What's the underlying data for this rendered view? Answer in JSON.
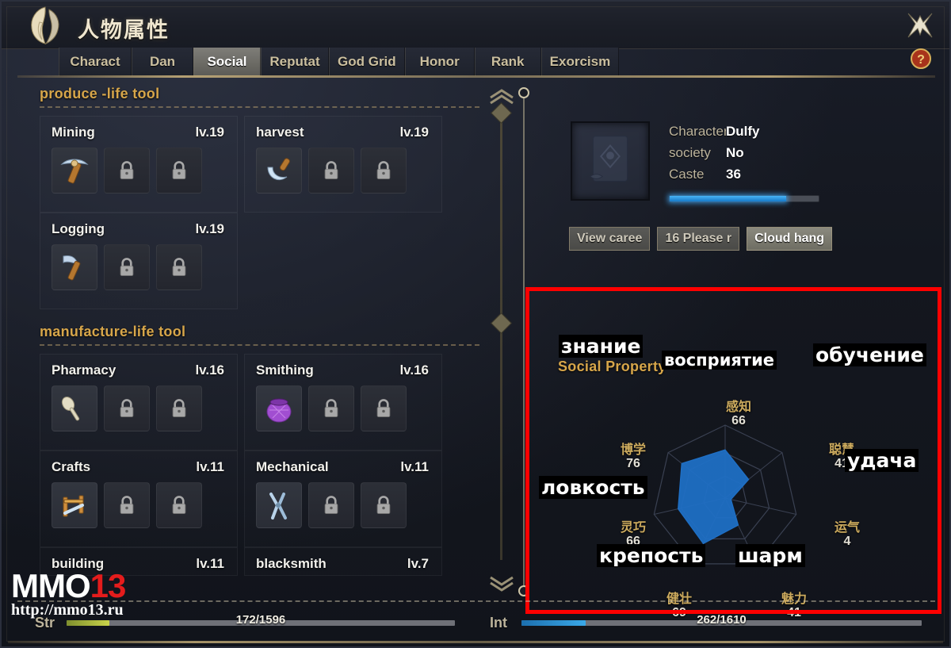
{
  "window": {
    "title_cn": "人物属性",
    "emblem_icon": "helmet-crest-icon",
    "close_icon": "close-star-icon",
    "help_icon": "help-question-icon"
  },
  "tabs": [
    {
      "label": "Charact",
      "active": false
    },
    {
      "label": "Dan",
      "active": false
    },
    {
      "label": "Social",
      "active": true
    },
    {
      "label": "Reputat",
      "active": false
    },
    {
      "label": "God Grid",
      "active": false
    },
    {
      "label": "Honor",
      "active": false
    },
    {
      "label": "Rank",
      "active": false
    },
    {
      "label": "Exorcism",
      "active": false
    }
  ],
  "left_panel": {
    "sections": [
      {
        "title": "produce -life tool",
        "skills": [
          {
            "name": "Mining",
            "level": "lv.19",
            "icon": "pickaxe-icon",
            "slots": [
              "tool",
              "locked",
              "locked"
            ]
          },
          {
            "name": "harvest",
            "level": "lv.19",
            "icon": "sickle-icon",
            "slots": [
              "tool",
              "locked",
              "locked"
            ]
          },
          {
            "name": "Logging",
            "level": "lv.19",
            "icon": "axe-icon",
            "slots": [
              "tool",
              "locked",
              "locked"
            ]
          }
        ]
      },
      {
        "title": "manufacture-life tool",
        "skills": [
          {
            "name": "Pharmacy",
            "level": "lv.16",
            "icon": "spoon-icon",
            "slots": [
              "tool",
              "locked",
              "locked"
            ]
          },
          {
            "name": "Smithing",
            "level": "lv.16",
            "icon": "pot-icon",
            "slots": [
              "tool",
              "locked",
              "locked"
            ]
          },
          {
            "name": "Crafts",
            "level": "lv.11",
            "icon": "loom-icon",
            "slots": [
              "tool",
              "locked",
              "locked"
            ]
          },
          {
            "name": "Mechanical",
            "level": "lv.11",
            "icon": "pliers-icon",
            "slots": [
              "tool",
              "locked",
              "locked"
            ]
          },
          {
            "name": "building",
            "level": "lv.11",
            "icon": "build-icon",
            "slots": []
          },
          {
            "name": "blacksmith",
            "level": "lv.7",
            "icon": "anvil-icon",
            "slots": []
          }
        ]
      }
    ]
  },
  "scrollbar": {
    "up_icon": "chevron-double-up-icon",
    "down_icon": "chevron-double-down-icon"
  },
  "right_panel": {
    "portrait_icon": "scroll-portrait-icon",
    "info_rows": [
      {
        "label": "Character",
        "value": "Dulfy"
      },
      {
        "label": "society",
        "value": "No"
      },
      {
        "label": "Caste",
        "value": "36"
      }
    ],
    "exp_percent": 78,
    "buttons": [
      {
        "label": "View caree",
        "style": "dim"
      },
      {
        "label": "16 Please r",
        "style": "dim"
      },
      {
        "label": "Cloud hang",
        "style": "bright"
      }
    ],
    "social_property_title": "Social Property"
  },
  "chart_data": {
    "type": "radar",
    "title": "Social Property",
    "categories": [
      "感知",
      "博学",
      "灵巧",
      "健壮",
      "魅力",
      "运气",
      "聪慧"
    ],
    "values": [
      66,
      76,
      66,
      69,
      41,
      4,
      41
    ],
    "max": 100,
    "fill_color": "#1f6fc4",
    "grid_color": "#3a4152",
    "labels_ru": [
      {
        "text": "знание",
        "for": "博学"
      },
      {
        "text": "восприятие",
        "for": "感知"
      },
      {
        "text": "обучение",
        "for": "聪慧"
      },
      {
        "text": "ловкость",
        "for": "灵巧"
      },
      {
        "text": "удача",
        "for": "运气"
      },
      {
        "text": "крепость",
        "for": "健壮"
      },
      {
        "text": "шарм",
        "for": "魅力"
      }
    ],
    "axes": [
      {
        "name_cn": "感知",
        "value": "66",
        "ru": "восприятие"
      },
      {
        "name_cn": "博学",
        "value": "76",
        "ru": "знание"
      },
      {
        "name_cn": "聪慧",
        "value": "41",
        "ru": "обучение"
      },
      {
        "name_cn": "灵巧",
        "value": "66",
        "ru": "ловкость"
      },
      {
        "name_cn": "运气",
        "value": "4",
        "ru": "удача"
      },
      {
        "name_cn": "健壮",
        "value": "69",
        "ru": "крепость"
      },
      {
        "name_cn": "魅力",
        "value": "41",
        "ru": "шарм"
      }
    ]
  },
  "bottom_bars": [
    {
      "name": "Str",
      "text": "172/1596",
      "percent": 11,
      "color": "#c9d44a"
    },
    {
      "name": "Int",
      "text": "262/1610",
      "percent": 16,
      "color": "#3aa8e8"
    }
  ],
  "watermark": {
    "brand_main": "MMO",
    "brand_accent": "13",
    "url": "http://mmo13.ru"
  },
  "annotation": {
    "highlight_color": "#ff0000"
  }
}
